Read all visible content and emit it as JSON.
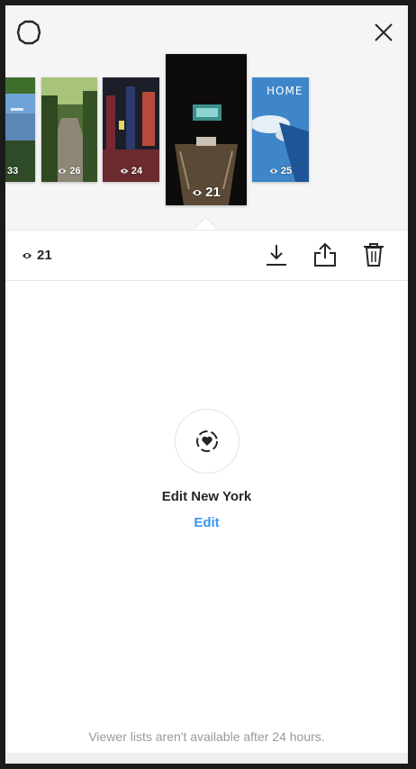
{
  "header": {
    "settings_icon": "gear-icon",
    "close_icon": "close-icon"
  },
  "stories": [
    {
      "views": "33",
      "scene": "park lake with trees"
    },
    {
      "views": "26",
      "scene": "tree-lined path"
    },
    {
      "views": "24",
      "scene": "times square at night"
    },
    {
      "views": "21",
      "scene": "subway stairs entrance",
      "selected": true
    },
    {
      "views": "25",
      "scene": "airplane window clouds",
      "overlay_text": "HOME"
    }
  ],
  "action_bar": {
    "view_count": "21",
    "eye_icon": "eye-icon",
    "download_icon": "download-icon",
    "share_icon": "share-icon",
    "delete_icon": "trash-icon"
  },
  "highlight": {
    "icon": "highlight-heart-icon",
    "title": "Edit New York",
    "edit_label": "Edit"
  },
  "footer": {
    "note": "Viewer lists aren't available after 24 hours."
  },
  "colors": {
    "accent": "#3897f0",
    "text": "#262626",
    "muted": "#999999"
  }
}
